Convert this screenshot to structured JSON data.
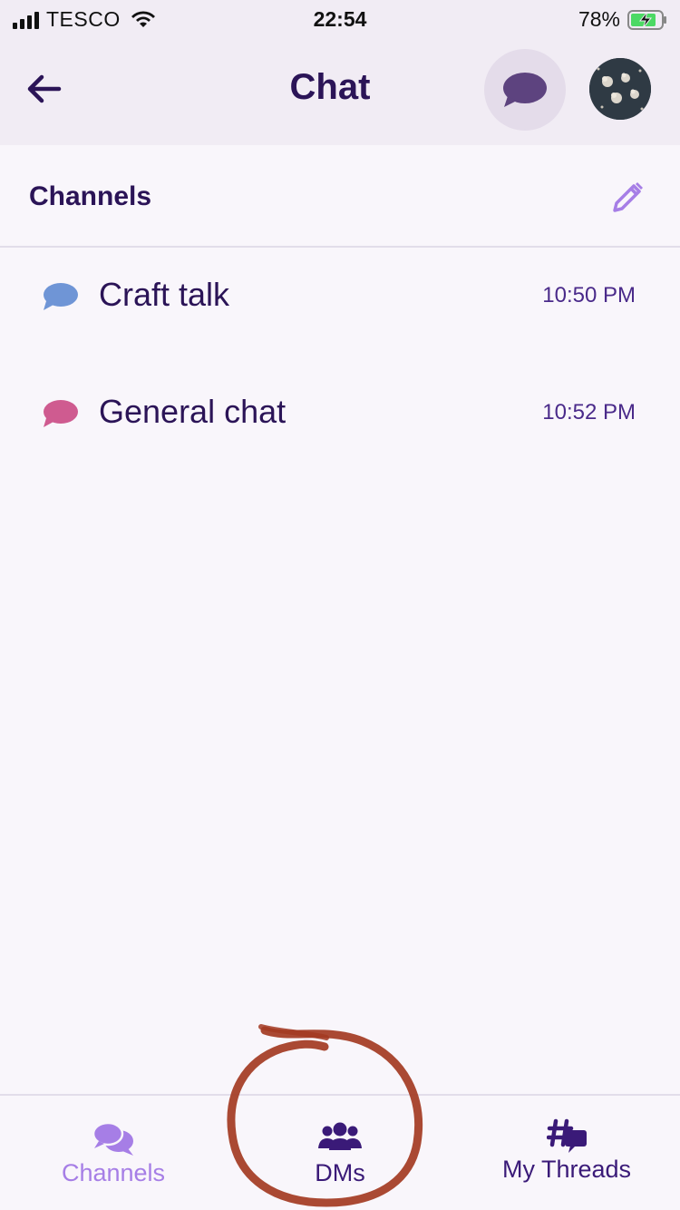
{
  "status_bar": {
    "carrier": "TESCO",
    "time": "22:54",
    "battery": "78%"
  },
  "header": {
    "title": "Chat",
    "back_icon": "arrow-left-icon",
    "chat_icon": "speech-bubble-icon",
    "avatar_icon": "avatar"
  },
  "section": {
    "title": "Channels",
    "edit_icon": "pencil-icon"
  },
  "channels": [
    {
      "name": "Craft talk",
      "time": "10:50 PM",
      "icon_color": "#6f95d6"
    },
    {
      "name": "General chat",
      "time": "10:52 PM",
      "icon_color": "#cf5b90"
    }
  ],
  "tabs": [
    {
      "label": "Channels",
      "icon": "chat-bubbles-icon",
      "active": true
    },
    {
      "label": "DMs",
      "icon": "users-icon",
      "active": false
    },
    {
      "label": "My Threads",
      "icon": "hashtag-thread-icon",
      "active": false
    }
  ],
  "colors": {
    "accent": "#a67ee6",
    "primary_text": "#2b1457",
    "header_bg": "#f1ecf4",
    "annotation": "#a33a22"
  }
}
